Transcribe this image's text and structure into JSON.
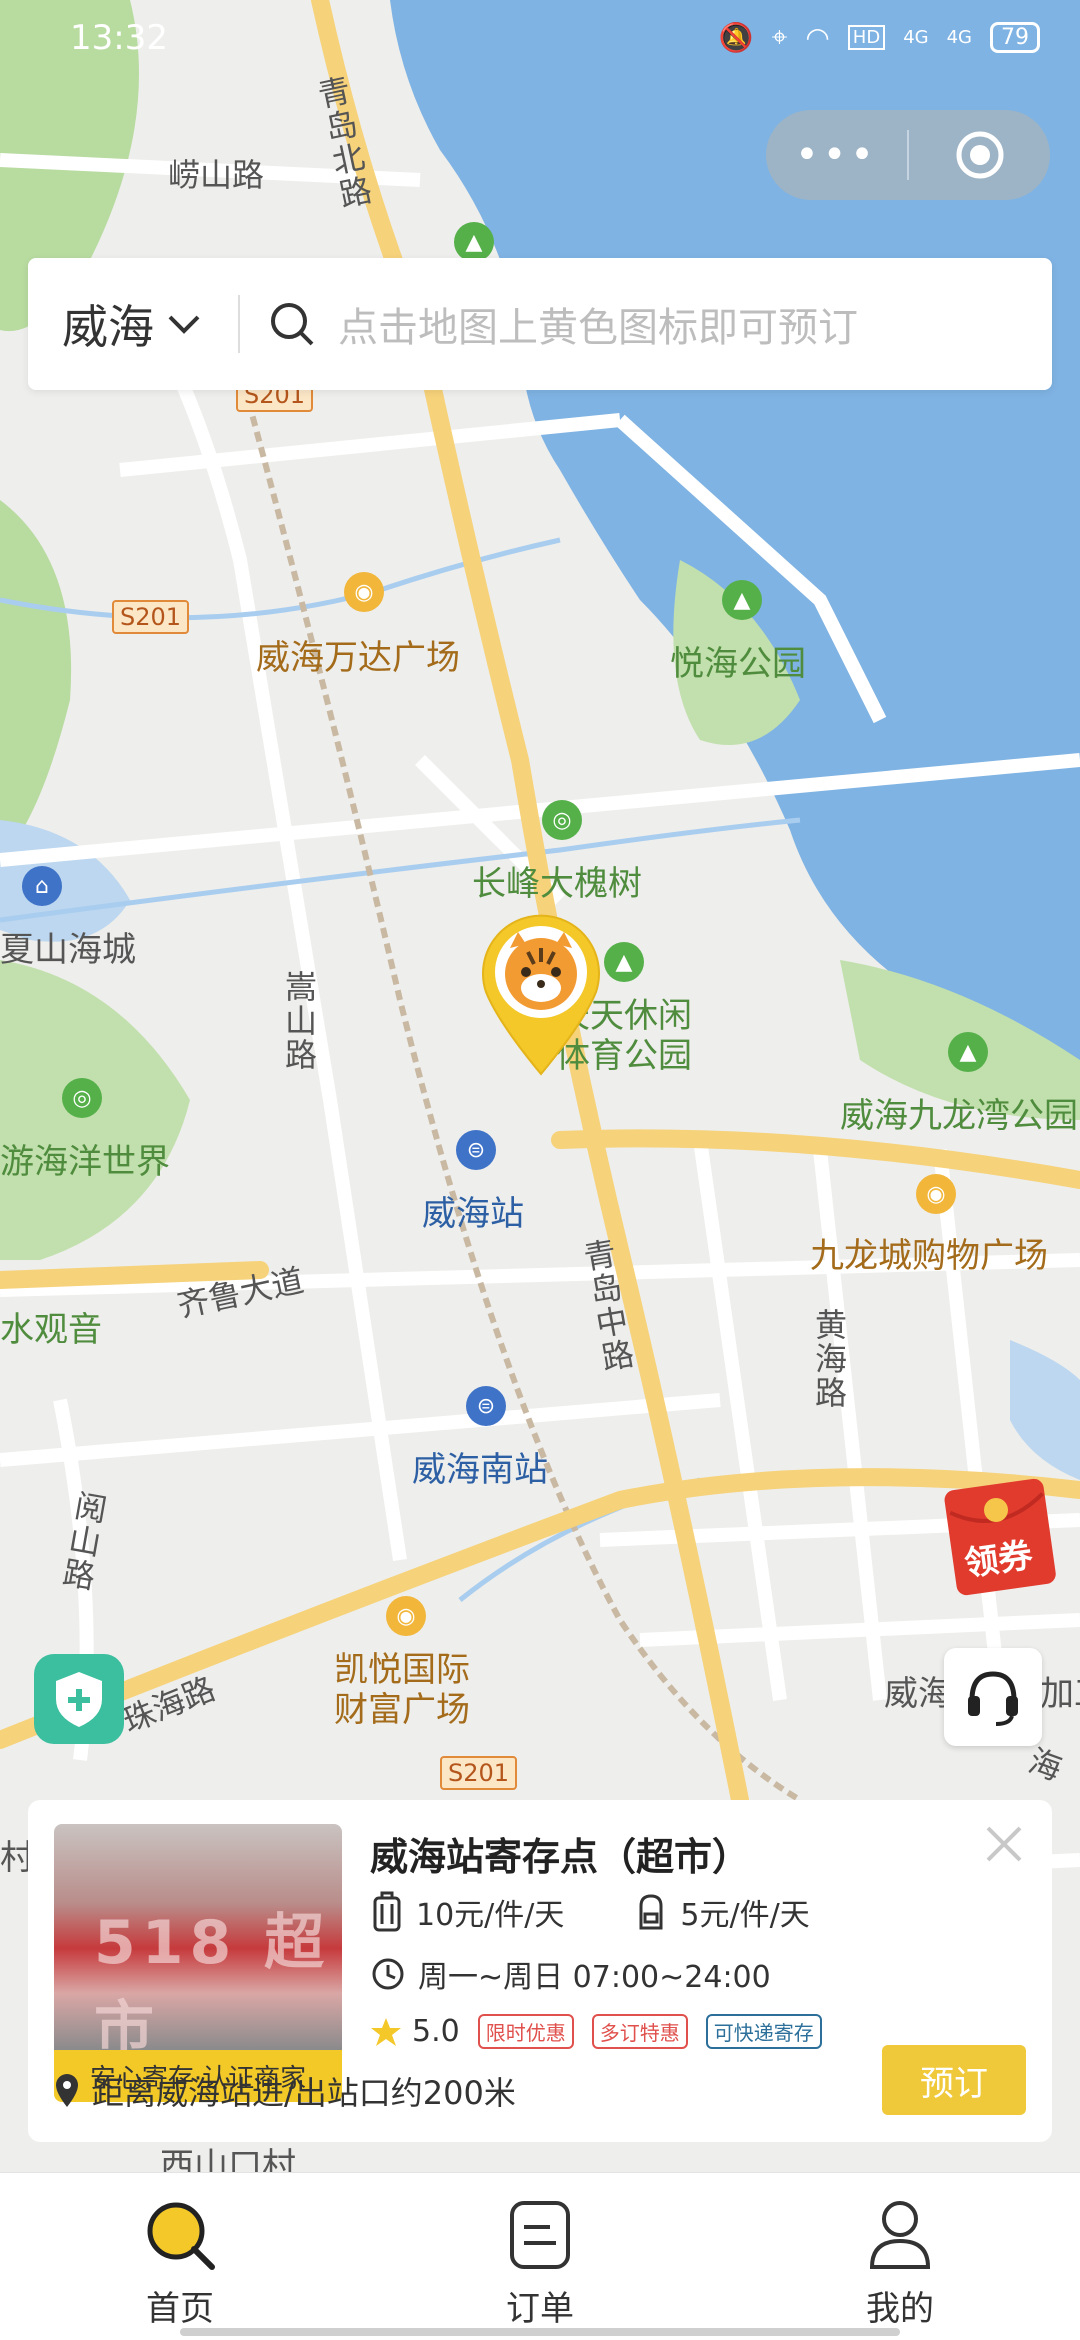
{
  "status_bar": {
    "time": "13:32",
    "battery": "79",
    "hd": "HD",
    "net1": "4G",
    "net2": "4G"
  },
  "header": {
    "city": "威海",
    "search_placeholder": "点击地图上黄色图标即可预订"
  },
  "map": {
    "labels": {
      "laoshan_road": "崂山路",
      "qingdao_north": "青岛北路",
      "s201_a": "S201",
      "s201_b": "S201",
      "s201_c": "S201",
      "wanda": "威海万达广场",
      "yuehai": "悦海公园",
      "changfeng": "长峰大槐树",
      "xiashan": "夏山海城",
      "songshan_road": "嵩山路",
      "tiantian": "天天休闲\n体育公园",
      "jiulongwan": "威海九龙湾公园",
      "youhai": "游海洋世界",
      "weihai_station": "威海站",
      "jiulongcheng": "九龙城购物广场",
      "qilu_road": "齐鲁大道",
      "shuiguanyin": "水观音",
      "qingdao_middle": "青岛中路",
      "huanghai_road": "黄海路",
      "weihai_south": "威海南站",
      "yueshan_road": "阅山路",
      "kaiyue": "凯悦国际\n财富广场",
      "zhuhai_road": "珠海路",
      "weihai_partial": "威海",
      "jiagong": "加工",
      "xishan_cun": "西山口村",
      "cun": "村",
      "hai_partial": "海"
    }
  },
  "coupon": {
    "label": "领券"
  },
  "card": {
    "title": "威海站寄存点（超市）",
    "thumb_text": "518 超市",
    "trust_label": "安心寄存·认证商家",
    "price_large": "10元/件/天",
    "price_small": "5元/件/天",
    "hours": "周一~周日 07:00~24:00",
    "rating": "5.0",
    "tags": [
      "限时优惠",
      "多订特惠",
      "可快递寄存"
    ],
    "distance": "距离威海站进/出站口约200米",
    "book_label": "预订"
  },
  "tabs": [
    {
      "label": "首页",
      "icon": "home-search-icon",
      "active": true
    },
    {
      "label": "订单",
      "icon": "order-icon",
      "active": false
    },
    {
      "label": "我的",
      "icon": "profile-icon",
      "active": false
    }
  ],
  "colors": {
    "accent": "#f0c93a",
    "sea": "#7fb3e3",
    "park": "#b8dba0",
    "road": "#f6d27a"
  }
}
